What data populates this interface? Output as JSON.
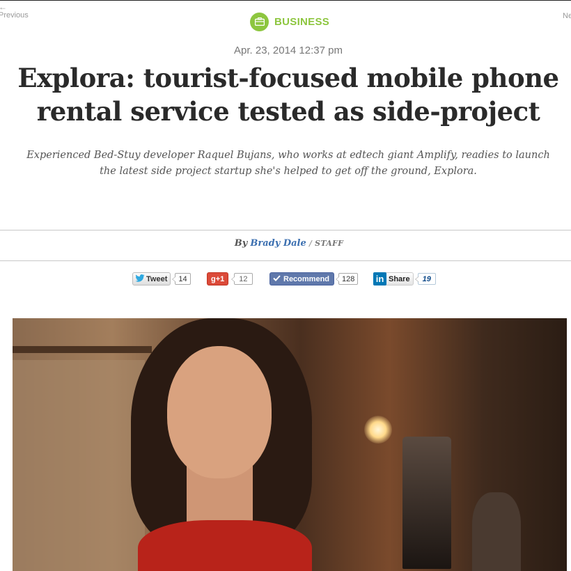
{
  "nav": {
    "previous_label": "Previous",
    "next_label": "Ne"
  },
  "category": {
    "label": "BUSINESS",
    "icon": "briefcase-icon",
    "color": "#8dc63f"
  },
  "article": {
    "date": "Apr. 23, 2014 12:37 pm",
    "headline": "Explora: tourist-focused mobile phone rental service tested as side-project",
    "dek": "Experienced Bed-Stuy developer Raquel Bujans, who works at edtech giant Amplify, readies to launch the latest side project startup she's helped to get off the ground, Explora.",
    "byline": {
      "by": "By",
      "author": "Brady Dale",
      "separator": "/",
      "role": "STAFF"
    }
  },
  "share": {
    "twitter": {
      "label": "Tweet",
      "count": "14",
      "icon": "twitter-bird-icon"
    },
    "gplus": {
      "label": "g+1",
      "count": "12"
    },
    "facebook": {
      "label": "Recommend",
      "count": "128",
      "icon": "check-icon"
    },
    "linkedin": {
      "logo": "in",
      "label": "Share",
      "count": "19"
    }
  },
  "colors": {
    "author_link": "#3b6fb0",
    "gplus": "#db4a39",
    "facebook": "#5f78ab",
    "linkedin": "#0077b5"
  }
}
